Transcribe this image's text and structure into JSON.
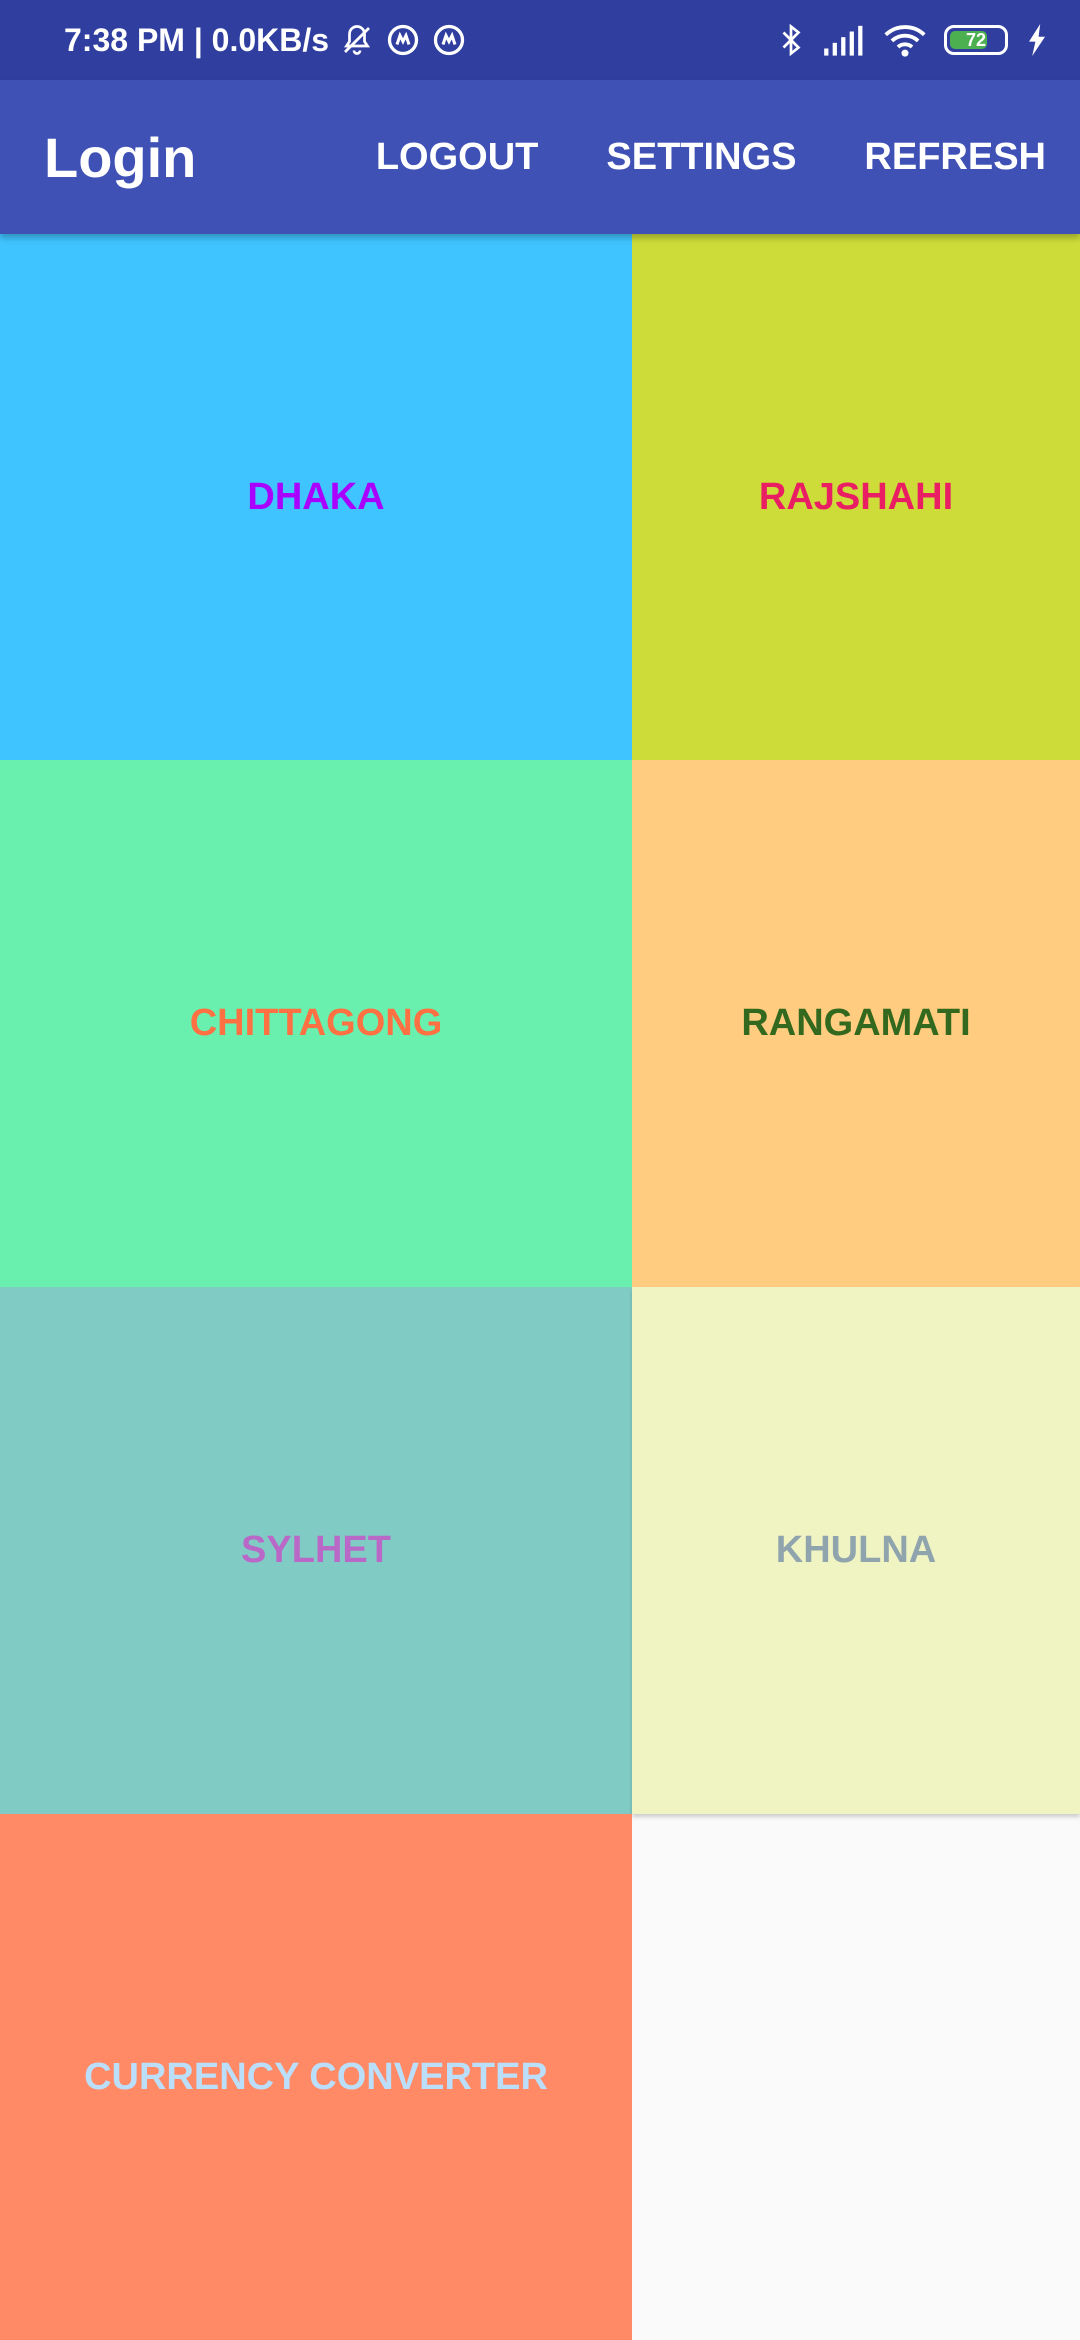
{
  "status_bar": {
    "time": "7:38 PM | 0.0KB/s",
    "battery_level": "72",
    "battery_fraction": 0.72,
    "icons": [
      "bell-off-icon",
      "sync-icon",
      "sync-icon",
      "bluetooth-icon",
      "signal-icon",
      "wifi-icon",
      "battery-icon",
      "charging-icon"
    ],
    "color": "#303f9f"
  },
  "app_bar": {
    "title": "Login",
    "actions": [
      "LOGOUT",
      "SETTINGS",
      "REFRESH"
    ],
    "color": "#3f51b5"
  },
  "tiles": [
    {
      "label": "DHAKA",
      "bg": "#40c4ff",
      "fg": "#aa00ff"
    },
    {
      "label": "RAJSHAHI",
      "bg": "#cddc39",
      "fg": "#e91e63"
    },
    {
      "label": "CHITTAGONG",
      "bg": "#69f0ae",
      "fg": "#ff7043"
    },
    {
      "label": "RANGAMATI",
      "bg": "#ffcc80",
      "fg": "#33691e"
    },
    {
      "label": "SYLHET",
      "bg": "#80cbc4",
      "fg": "#ba68c8"
    },
    {
      "label": "KHULNA",
      "bg": "#f0f4c3",
      "fg": "#90a4ae"
    },
    {
      "label": "CURRENCY CONVERTER",
      "bg": "#ff8a65",
      "fg": "#bbdefb"
    }
  ]
}
